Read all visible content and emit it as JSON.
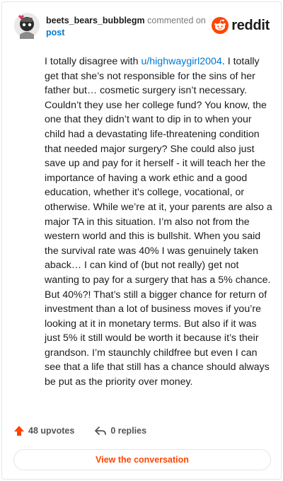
{
  "header": {
    "username": "beets_bears_bubblegm",
    "action": "commented on",
    "post_link": "post",
    "brand": "reddit"
  },
  "comment": {
    "before_mention": "I totally disagree with ",
    "mention": "u/highwaygirl2004",
    "after_mention": ". I totally get that she’s not responsible for the sins of her father but… cosmetic surgery isn’t necessary. Couldn’t they use her college fund? You know, the one that they didn’t want to dip in to when your child had a devastating life-threatening condition that needed major surgery? She could also just save up and pay for it herself - it will teach her the importance of having a work ethic and a good education, whether it’s college, vocational, or otherwise. While we’re at it, your parents are also a major TA in this situation. I’m also not from the western world and this is bullshit. When you said the survival rate was 40% I was genuinely taken aback… I can kind of (but not really) get not wanting to pay for a surgery that has a 5% chance. But 40%?! That’s still a bigger chance for return of investment than a lot of business moves if you’re looking at it in monetary terms. But also if it was just 5% it still would be worth it because it’s their grandson. I’m staunchly childfree but even I can see that a life that still has a chance should always be put as the priority over money."
  },
  "footer": {
    "upvotes": "48 upvotes",
    "replies": "0 replies",
    "cta": "View the conversation"
  },
  "colors": {
    "accent": "#ff4500",
    "link": "#0079d3",
    "text": "#1c1c1c",
    "muted": "#7c7c7c"
  },
  "icons": [
    "avatar",
    "reddit-logo-icon",
    "upvote-arrow-icon",
    "reply-arrow-icon"
  ]
}
